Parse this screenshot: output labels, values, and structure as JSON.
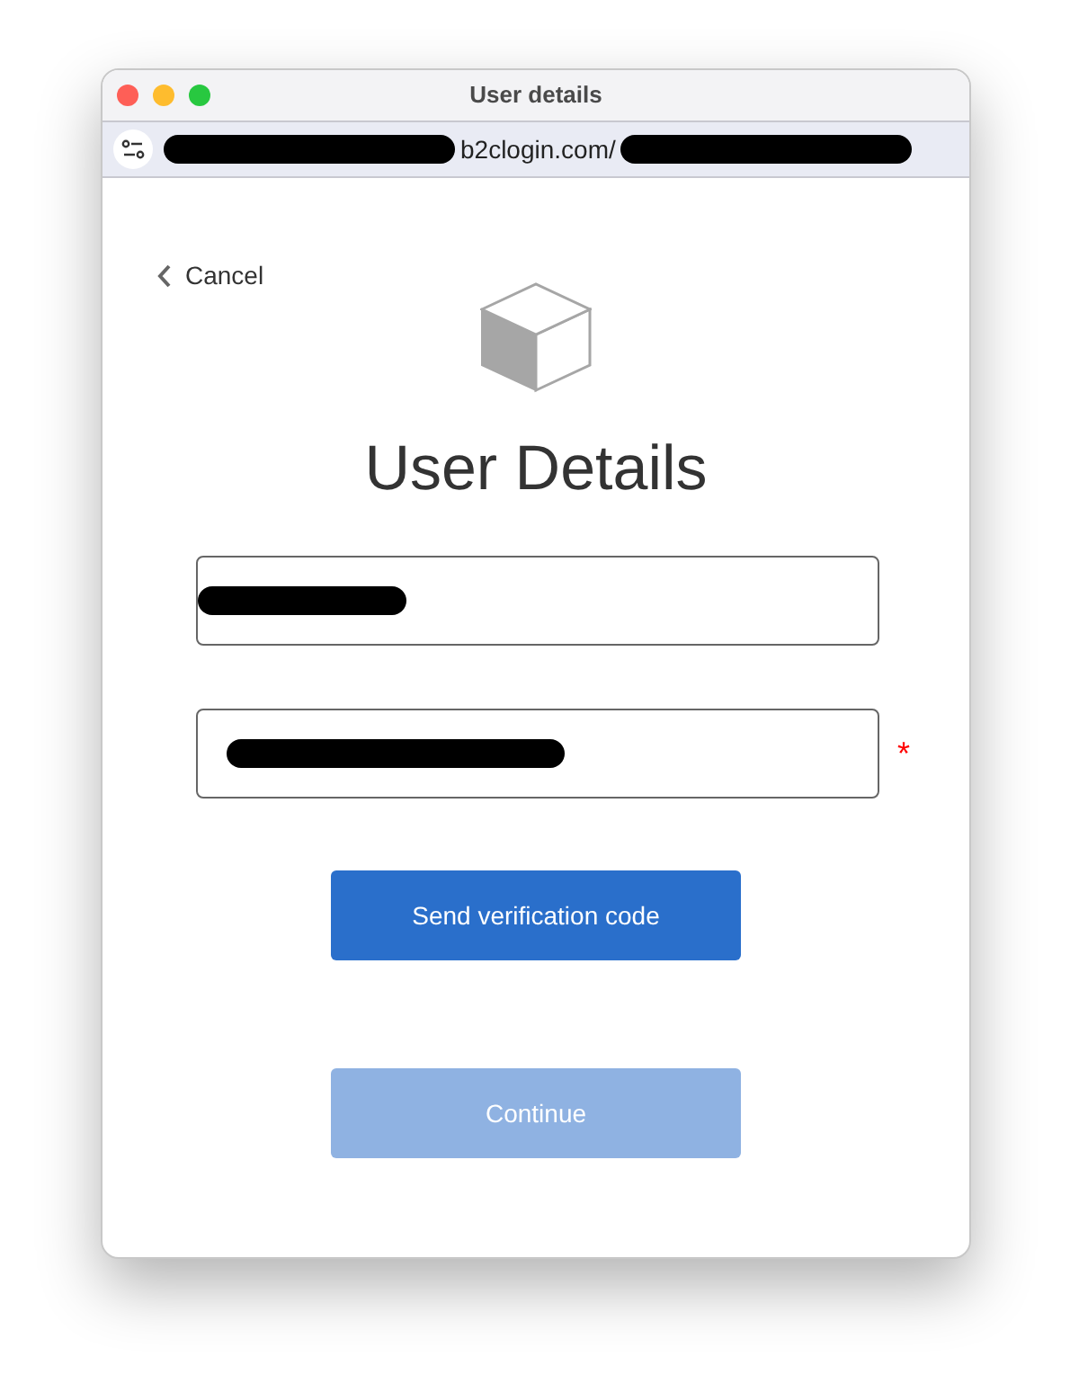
{
  "window": {
    "title": "User details"
  },
  "address_bar": {
    "url_visible": "b2clogin.com/"
  },
  "cancel_link": {
    "label": "Cancel"
  },
  "heading": "User Details",
  "required_mark": "*",
  "fields": [
    {
      "required": false
    },
    {
      "required": true
    }
  ],
  "buttons": [
    {
      "label": "Send verification code",
      "disabled": false
    },
    {
      "label": "Continue",
      "disabled": true
    }
  ]
}
